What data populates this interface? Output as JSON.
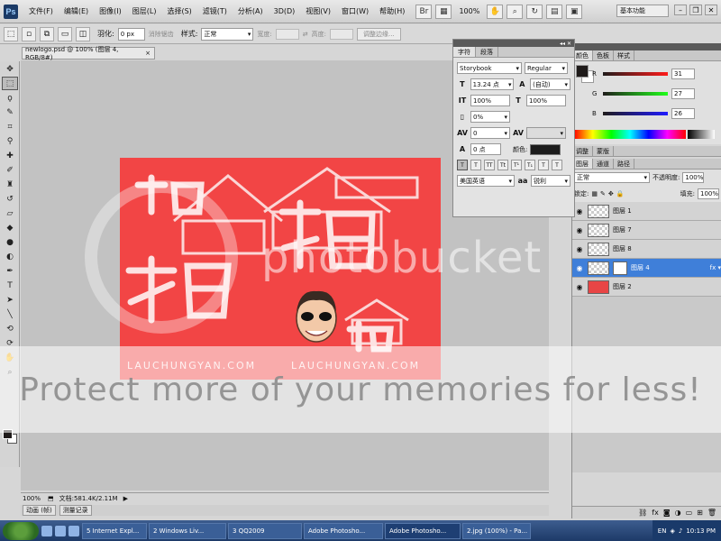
{
  "menubar": {
    "logo": "Ps",
    "items": [
      "文件(F)",
      "编辑(E)",
      "图像(I)",
      "图层(L)",
      "选择(S)",
      "滤镜(T)",
      "分析(A)",
      "3D(D)",
      "视图(V)",
      "窗口(W)",
      "帮助(H)"
    ],
    "zoom": "100%",
    "workspace": "基本功能"
  },
  "options": {
    "feather_label": "羽化:",
    "feather_value": "0 px",
    "antialias_label": "消除锯齿",
    "style_label": "样式:",
    "style_value": "正常",
    "width_label": "宽度:",
    "height_label": "高度:",
    "refine_button": "调整边缘..."
  },
  "document": {
    "tab_title": "newlogo.psd @ 100% (图层 4, RGB/8#)",
    "status_zoom": "100%",
    "status_doc": "文档:581.4K/2.11M",
    "bottom_tabs": [
      "动画 (帧)",
      "测量记录"
    ],
    "canvas_color": "#f24545"
  },
  "character_panel": {
    "tabs": [
      "字符",
      "段落"
    ],
    "font_family": "Storybook",
    "font_style": "Regular",
    "font_size": "13.24 点",
    "leading": "(自动)",
    "vertical_scale": "100%",
    "horizontal_scale": "100%",
    "tracking_ratio": "0%",
    "kerning": "0",
    "baseline_shift": "0 点",
    "color_label": "颜色:",
    "language": "美国英语",
    "antialias": "锐利",
    "text_color": "#1c1c1c"
  },
  "color_panel": {
    "tabs": [
      "颜色",
      "色板",
      "样式"
    ],
    "channels": [
      {
        "label": "R",
        "value": "31"
      },
      {
        "label": "G",
        "value": "27"
      },
      {
        "label": "B",
        "value": "26"
      }
    ],
    "foreground": "#1f1b1a"
  },
  "adjust_tabs": [
    "调整",
    "蒙版"
  ],
  "layers_panel": {
    "tabs": [
      "图层",
      "通道",
      "路径"
    ],
    "blend_mode": "正常",
    "opacity_label": "不透明度:",
    "opacity_value": "100%",
    "lock_label": "锁定:",
    "fill_label": "填充:",
    "fill_value": "100%",
    "layers": [
      {
        "name": "图层 1",
        "selected": false
      },
      {
        "name": "图层 7",
        "selected": false
      },
      {
        "name": "图层 8",
        "selected": false
      },
      {
        "name": "图层 4",
        "selected": true
      },
      {
        "name": "图层 2",
        "selected": false
      }
    ]
  },
  "taskbar": {
    "items": [
      "5 Internet Expl...",
      "2 Windows Liv...",
      "3 QQ2009",
      "Adobe Photosho...",
      "Adobe Photosho...",
      "2.jpg (100%) - Pa..."
    ],
    "active_index": 4,
    "lang": "EN",
    "clock": "10:13 PM"
  },
  "watermark": {
    "logo": "photobucket",
    "text": "Protect more of your memories for less!"
  }
}
